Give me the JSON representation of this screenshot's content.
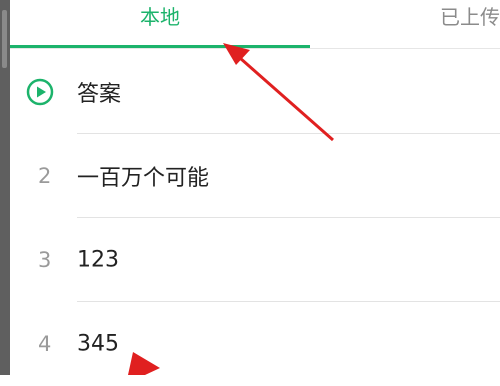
{
  "tabs": {
    "local_label": "本地",
    "uploaded_label": "已上传"
  },
  "songs": [
    {
      "number": "",
      "title": "答案",
      "playing": true
    },
    {
      "number": "2",
      "title": "一百万个可能"
    },
    {
      "number": "3",
      "title": "123"
    },
    {
      "number": "4",
      "title": "345"
    }
  ],
  "colors": {
    "accent": "#1cb36b",
    "annotation_arrow": "#e02020"
  },
  "icons": {
    "play": "play-circle-icon"
  }
}
